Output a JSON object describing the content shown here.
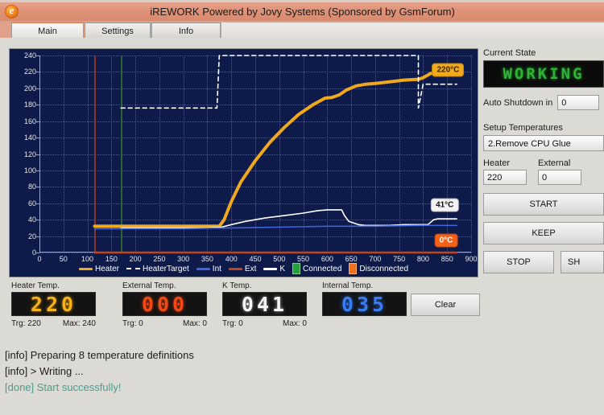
{
  "window": {
    "title": "iREWORK Powered by Jovy Systems (Sponsored by GsmForum)",
    "app_icon": "app-e-icon"
  },
  "tabs": [
    {
      "label": "Main",
      "selected": true
    },
    {
      "label": "Settings",
      "selected": false
    },
    {
      "label": "Info",
      "selected": false
    }
  ],
  "chart_data": {
    "type": "line",
    "title": "",
    "xlabel": "",
    "ylabel": "",
    "xlim": [
      0,
      900
    ],
    "ylim": [
      0,
      240
    ],
    "xticks": [
      0,
      50,
      100,
      150,
      200,
      250,
      300,
      350,
      400,
      450,
      500,
      550,
      600,
      650,
      700,
      750,
      800,
      850,
      900
    ],
    "yticks": [
      0,
      20,
      40,
      60,
      80,
      100,
      120,
      140,
      160,
      180,
      200,
      220,
      240
    ],
    "grid": true,
    "legend_position": "bottom",
    "background": "#0d1a4a",
    "legend": [
      {
        "label": "Heater",
        "color": "#f0a81c",
        "style": "solid"
      },
      {
        "label": "HeaterTarget",
        "color": "#ffffff",
        "style": "dashed"
      },
      {
        "label": "Int",
        "color": "#3f63d8",
        "style": "solid"
      },
      {
        "label": "Ext",
        "color": "#c0451c",
        "style": "solid"
      },
      {
        "label": "K",
        "color": "#ffffff",
        "style": "solid"
      },
      {
        "label": "Connected",
        "color": "#23a03a",
        "style": "marker"
      },
      {
        "label": "Disconnected",
        "color": "#f0701c",
        "style": "marker"
      }
    ],
    "series": [
      {
        "name": "Heater",
        "color": "#f0a81c",
        "x": [
          115,
          140,
          170,
          200,
          250,
          300,
          350,
          375,
          385,
          400,
          420,
          450,
          480,
          510,
          540,
          570,
          595,
          610,
          625,
          640,
          660,
          680,
          700,
          730,
          760,
          790,
          800,
          815,
          830,
          850,
          870
        ],
        "y": [
          32,
          32,
          32,
          32,
          32,
          32,
          32,
          32,
          40,
          62,
          86,
          112,
          134,
          152,
          168,
          180,
          188,
          189,
          192,
          198,
          203,
          205,
          206,
          208,
          210,
          211,
          213,
          218,
          220,
          220,
          220
        ]
      },
      {
        "name": "HeaterTarget",
        "color": "#ffffff",
        "style": "dashed",
        "x": [
          170,
          370,
          370,
          375,
          790,
          790,
          800,
          870
        ],
        "y": [
          176,
          176,
          176,
          240,
          240,
          176,
          205,
          205
        ]
      },
      {
        "name": "K",
        "color": "#ffffff",
        "x": [
          170,
          250,
          300,
          350,
          380,
          400,
          430,
          470,
          510,
          550,
          580,
          600,
          620,
          630,
          636,
          645,
          655,
          665,
          680,
          700,
          730,
          760,
          790,
          810,
          822,
          830,
          850,
          870
        ],
        "y": [
          30,
          30,
          30,
          30,
          31,
          34,
          38,
          42,
          45,
          48,
          51,
          52,
          52,
          52,
          45,
          38,
          36,
          34,
          33,
          33,
          33,
          34,
          34,
          34,
          40,
          41,
          41,
          41
        ]
      },
      {
        "name": "Int",
        "color": "#3f63d8",
        "x": [
          115,
          200,
          300,
          400,
          500,
          600,
          700,
          800,
          870
        ],
        "y": [
          29,
          29,
          29,
          30,
          31,
          32,
          32,
          33,
          33
        ]
      },
      {
        "name": "Ext",
        "color": "#c0451c",
        "x": [
          115,
          300,
          500,
          700,
          870
        ],
        "y": [
          0,
          0,
          0,
          0,
          0
        ]
      }
    ],
    "markers": [
      {
        "label": "Disconnected",
        "x": 115,
        "color": "#9c3b22"
      },
      {
        "label": "Connected",
        "x": 170,
        "color": "#2f6b2f"
      }
    ],
    "annotations": [
      {
        "text": "220°C",
        "x": 852,
        "y": 222,
        "style": "amber"
      },
      {
        "text": "41°C",
        "x": 845,
        "y": 58,
        "style": "white"
      },
      {
        "text": "0°C",
        "x": 848,
        "y": 15,
        "style": "orange"
      }
    ]
  },
  "side_panel": {
    "current_state_label": "Current State",
    "current_state_value": "WORKING",
    "auto_shutdown_label": "Auto Shutdown in",
    "auto_shutdown_value": "0",
    "setup_temperatures_label": "Setup Temperatures",
    "profile_selected": "2.Remove CPU Glue",
    "heater_label": "Heater",
    "heater_value": "220",
    "external_label": "External",
    "external_value": "0",
    "buttons": {
      "start": "START",
      "keep": "KEEP",
      "stop": "STOP",
      "shutdown": "SH"
    }
  },
  "gauges": [
    {
      "caption": "Heater Temp.",
      "value": "220",
      "color_class": "seg-amber",
      "trg": "Trg: 220",
      "max": "Max: 240"
    },
    {
      "caption": "External Temp.",
      "value": "000",
      "color_class": "seg-red",
      "trg": "Trg: 0",
      "max": "Max: 0"
    },
    {
      "caption": "K Temp.",
      "value": "041",
      "color_class": "seg-white",
      "trg": "Trg: 0",
      "max": "Max: 0"
    },
    {
      "caption": "Internal Temp.",
      "value": "035",
      "color_class": "seg-blue",
      "trg": "",
      "max": ""
    }
  ],
  "clear_button": "Clear",
  "log": [
    {
      "text": "[info] Preparing 8 temperature definitions",
      "type": "info"
    },
    {
      "text": "[info] > Writing ...",
      "type": "info"
    },
    {
      "text": "[done] Start successfully!",
      "type": "done"
    }
  ]
}
